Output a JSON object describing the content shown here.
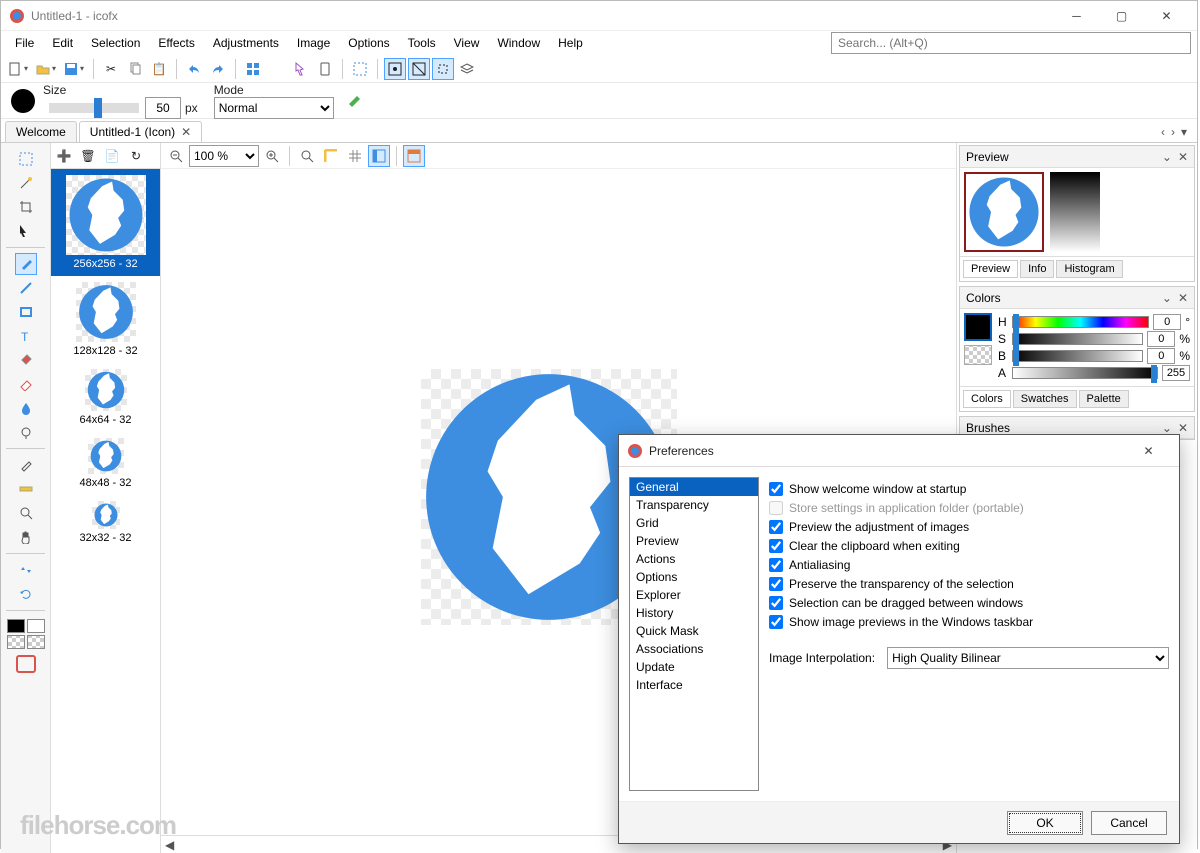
{
  "window": {
    "title": "Untitled-1 - icofx"
  },
  "menu": [
    "File",
    "Edit",
    "Selection",
    "Effects",
    "Adjustments",
    "Image",
    "Options",
    "Tools",
    "View",
    "Window",
    "Help"
  ],
  "search": {
    "placeholder": "Search... (Alt+Q)"
  },
  "brush": {
    "sizeLabel": "Size",
    "sizeValue": "50",
    "sizeUnit": "px",
    "modeLabel": "Mode",
    "modeValue": "Normal"
  },
  "tabs": {
    "welcome": "Welcome",
    "doc": "Untitled-1 (Icon)"
  },
  "zoom": "100 %",
  "thumbs": [
    {
      "caption": "256x256 - 32",
      "size": 80,
      "sel": true
    },
    {
      "caption": "128x128 - 32",
      "size": 60
    },
    {
      "caption": "64x64 - 32",
      "size": 42
    },
    {
      "caption": "48x48 - 32",
      "size": 36
    },
    {
      "caption": "32x32 - 32",
      "size": 28
    }
  ],
  "panels": {
    "preview": {
      "title": "Preview",
      "tabs": [
        "Preview",
        "Info",
        "Histogram"
      ]
    },
    "colors": {
      "title": "Colors",
      "tabs": [
        "Colors",
        "Swatches",
        "Palette"
      ],
      "h": "0",
      "s": "0",
      "b": "0",
      "a": "255",
      "unitDeg": "°",
      "unitPct": "%"
    },
    "brushes": {
      "title": "Brushes"
    }
  },
  "dialog": {
    "title": "Preferences",
    "categories": [
      "General",
      "Transparency",
      "Grid",
      "Preview",
      "Actions",
      "Options",
      "Explorer",
      "History",
      "Quick Mask",
      "Associations",
      "Update",
      "Interface"
    ],
    "selected": "General",
    "opts": {
      "welcome": "Show welcome window at startup",
      "portable": "Store settings in application folder (portable)",
      "previewAdj": "Preview the adjustment of images",
      "clearClip": "Clear the clipboard when exiting",
      "antialias": "Antialiasing",
      "preserveTrans": "Preserve the transparency of the selection",
      "dragWin": "Selection can be dragged between windows",
      "taskbar": "Show image previews in the Windows taskbar",
      "interpLabel": "Image Interpolation:",
      "interpValue": "High Quality Bilinear"
    },
    "ok": "OK",
    "cancel": "Cancel"
  },
  "hsbaLabels": {
    "h": "H",
    "s": "S",
    "b": "B",
    "a": "A"
  },
  "watermark": "filehorse.com"
}
